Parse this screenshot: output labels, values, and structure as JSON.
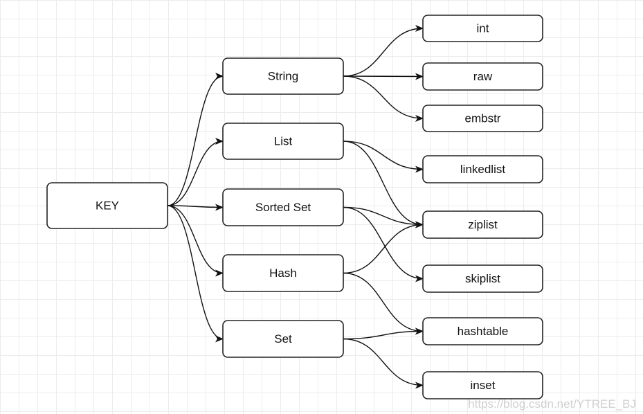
{
  "nodes": [
    {
      "id": "key",
      "label": "KEY"
    },
    {
      "id": "string",
      "label": "String"
    },
    {
      "id": "list",
      "label": "List"
    },
    {
      "id": "sortedset",
      "label": "Sorted Set"
    },
    {
      "id": "hash",
      "label": "Hash"
    },
    {
      "id": "set",
      "label": "Set"
    },
    {
      "id": "int",
      "label": "int"
    },
    {
      "id": "raw",
      "label": "raw"
    },
    {
      "id": "embstr",
      "label": "embstr"
    },
    {
      "id": "linkedlist",
      "label": "linkedlist"
    },
    {
      "id": "ziplist",
      "label": "ziplist"
    },
    {
      "id": "skiplist",
      "label": "skiplist"
    },
    {
      "id": "hashtable",
      "label": "hashtable"
    },
    {
      "id": "inset",
      "label": "inset"
    }
  ],
  "edges": [
    [
      "key",
      "string"
    ],
    [
      "key",
      "list"
    ],
    [
      "key",
      "sortedset"
    ],
    [
      "key",
      "hash"
    ],
    [
      "key",
      "set"
    ],
    [
      "string",
      "int"
    ],
    [
      "string",
      "raw"
    ],
    [
      "string",
      "embstr"
    ],
    [
      "list",
      "linkedlist"
    ],
    [
      "list",
      "ziplist"
    ],
    [
      "sortedset",
      "ziplist"
    ],
    [
      "sortedset",
      "skiplist"
    ],
    [
      "hash",
      "ziplist"
    ],
    [
      "hash",
      "hashtable"
    ],
    [
      "set",
      "hashtable"
    ],
    [
      "set",
      "inset"
    ]
  ],
  "watermark": "https://blog.csdn.net/YTREE_BJ"
}
